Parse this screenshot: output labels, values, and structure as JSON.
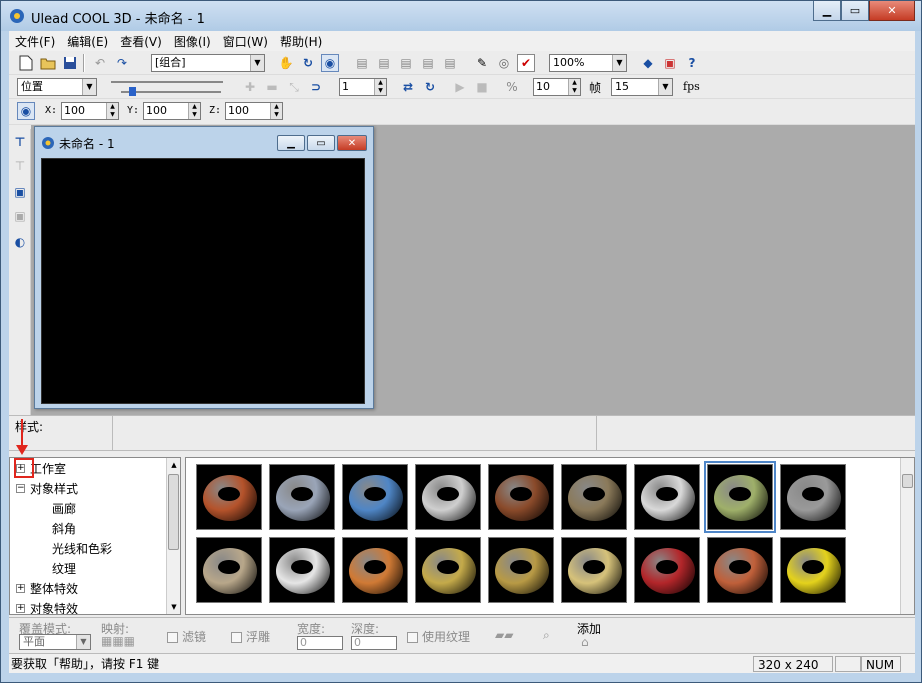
{
  "window": {
    "title": "Ulead COOL 3D - 未命名 - 1",
    "caption": {
      "minimize": "▁",
      "maximize": "▭",
      "close": "✕"
    }
  },
  "menu": [
    "文件(F)",
    "编辑(E)",
    "查看(V)",
    "图像(I)",
    "窗口(W)",
    "帮助(H)"
  ],
  "toolbar1": {
    "object_select": "[组合]",
    "zoom": "100%"
  },
  "toolbar2": {
    "attr_select": "位置",
    "frame_value": "1",
    "fps_frames": "10",
    "frame_label": "帧",
    "fps_value": "15",
    "fps_label": "fps"
  },
  "toolbar3": {
    "x_label": "X:",
    "x_value": "100",
    "y_label": "Y:",
    "y_value": "100",
    "z_label": "Z:",
    "z_value": "100"
  },
  "child_window": {
    "title": "未命名 - 1"
  },
  "style_bar": {
    "label": "样式:"
  },
  "tree": {
    "items": [
      {
        "label": "工作室",
        "expander": "+"
      },
      {
        "label": "对象样式",
        "expander": "−"
      },
      {
        "label": "画廊"
      },
      {
        "label": "斜角"
      },
      {
        "label": "光线和色彩"
      },
      {
        "label": "纹理"
      },
      {
        "label": "整体特效",
        "expander": "+"
      },
      {
        "label": "对象特效",
        "expander": "+"
      }
    ]
  },
  "gallery": {
    "thumbnails": [
      {
        "name": "red-brick",
        "color": "#b5532b"
      },
      {
        "name": "silver-pattern",
        "color": "#9aa5b8"
      },
      {
        "name": "blue-stone",
        "color": "#4f86c6"
      },
      {
        "name": "white-brick",
        "color": "#cfcfcf"
      },
      {
        "name": "wood-grain",
        "color": "#8a4a2a"
      },
      {
        "name": "rock",
        "color": "#8b7a5a"
      },
      {
        "name": "marble",
        "color": "#d9d9d9"
      },
      {
        "name": "green-lichen",
        "color": "#9fb06a"
      },
      {
        "name": "granite",
        "color": "#9a9a9a"
      },
      {
        "name": "sand",
        "color": "#b8a78a"
      },
      {
        "name": "chrome",
        "color": "#e6e6e6"
      },
      {
        "name": "copper",
        "color": "#d07a35"
      },
      {
        "name": "gold",
        "color": "#c4aa4a"
      },
      {
        "name": "bronze",
        "color": "#b89a45"
      },
      {
        "name": "brass",
        "color": "#d6c27a"
      },
      {
        "name": "red-tile",
        "color": "#b3262a"
      },
      {
        "name": "orange-brick",
        "color": "#c0603a"
      },
      {
        "name": "yellow",
        "color": "#e4d21c"
      }
    ]
  },
  "props": {
    "cover_mode_label": "覆盖模式:",
    "cover_mode_value": "平面",
    "mapping_label": "映射:",
    "filter_label": "滤镜",
    "emboss_label": "浮雕",
    "width_label": "宽度:",
    "width_value": "0",
    "depth_label": "深度:",
    "depth_value": "0",
    "use_texture_label": "使用纹理",
    "add_label": "添加"
  },
  "status": {
    "help_text": "要获取「帮助」，请按 F1 键",
    "size": "320 x 240",
    "num": "NUM"
  }
}
